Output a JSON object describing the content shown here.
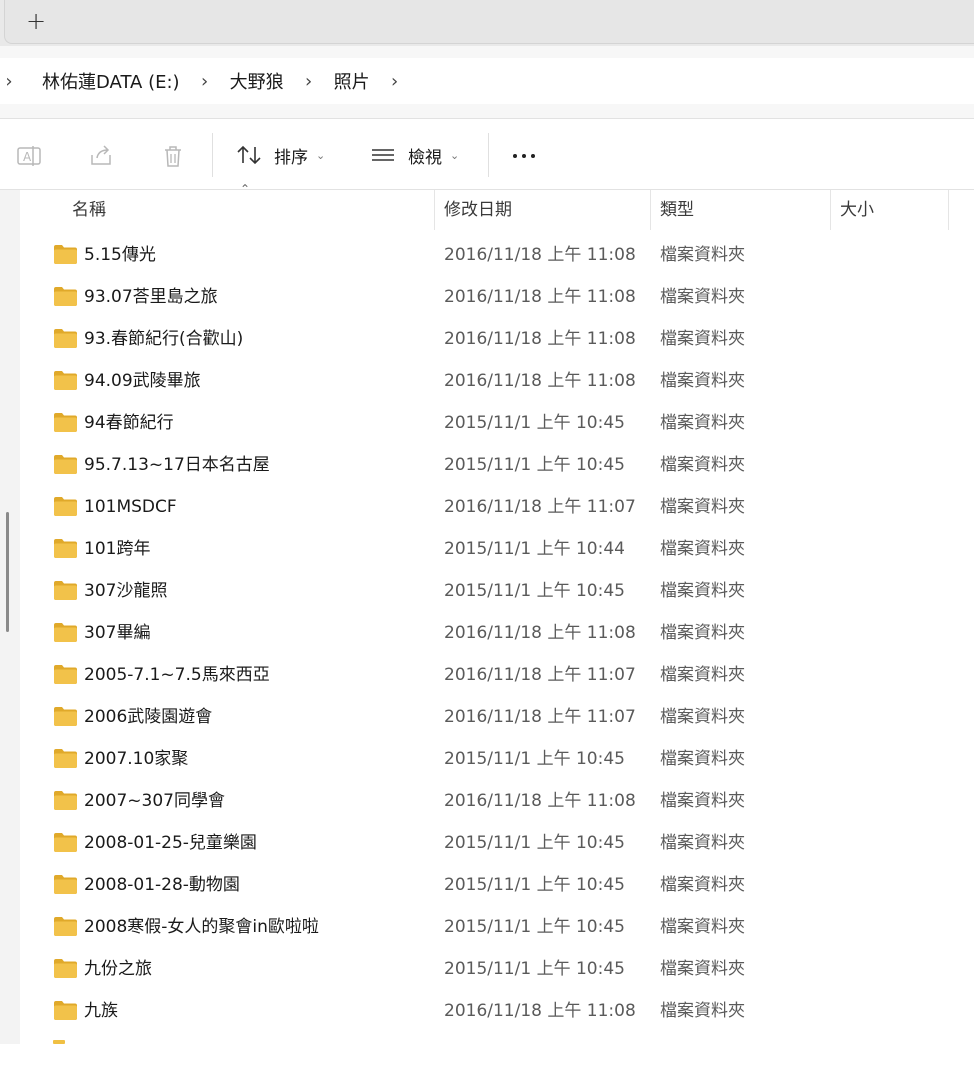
{
  "tabstrip": {
    "new_tab_label": "+"
  },
  "breadcrumb": {
    "items": [
      "林佑蓮DATA (E:)",
      "大野狼",
      "照片"
    ]
  },
  "toolbar": {
    "sort_label": "排序",
    "view_label": "檢視",
    "more_label": "..."
  },
  "columns": {
    "name": "名稱",
    "date": "修改日期",
    "type": "類型",
    "size": "大小"
  },
  "colors": {
    "folder": "#f2c24a",
    "folder_dark": "#e0a92a"
  },
  "files": [
    {
      "name": "5.15傳光",
      "date": "2016/11/18 上午 11:08",
      "type": "檔案資料夾"
    },
    {
      "name": "93.07荅里島之旅",
      "date": "2016/11/18 上午 11:08",
      "type": "檔案資料夾"
    },
    {
      "name": "93.春節紀行(合歡山)",
      "date": "2016/11/18 上午 11:08",
      "type": "檔案資料夾"
    },
    {
      "name": "94.09武陵畢旅",
      "date": "2016/11/18 上午 11:08",
      "type": "檔案資料夾"
    },
    {
      "name": "94春節紀行",
      "date": "2015/11/1 上午 10:45",
      "type": "檔案資料夾"
    },
    {
      "name": "95.7.13~17日本名古屋",
      "date": "2015/11/1 上午 10:45",
      "type": "檔案資料夾"
    },
    {
      "name": "101MSDCF",
      "date": "2016/11/18 上午 11:07",
      "type": "檔案資料夾"
    },
    {
      "name": "101跨年",
      "date": "2015/11/1 上午 10:44",
      "type": "檔案資料夾"
    },
    {
      "name": "307沙龍照",
      "date": "2015/11/1 上午 10:45",
      "type": "檔案資料夾"
    },
    {
      "name": "307畢編",
      "date": "2016/11/18 上午 11:08",
      "type": "檔案資料夾"
    },
    {
      "name": "2005-7.1~7.5馬來西亞",
      "date": "2016/11/18 上午 11:07",
      "type": "檔案資料夾"
    },
    {
      "name": "2006武陵園遊會",
      "date": "2016/11/18 上午 11:07",
      "type": "檔案資料夾"
    },
    {
      "name": "2007.10家聚",
      "date": "2015/11/1 上午 10:45",
      "type": "檔案資料夾"
    },
    {
      "name": "2007~307同學會",
      "date": "2016/11/18 上午 11:08",
      "type": "檔案資料夾"
    },
    {
      "name": "2008-01-25-兒童樂園",
      "date": "2015/11/1 上午 10:45",
      "type": "檔案資料夾"
    },
    {
      "name": "2008-01-28-動物園",
      "date": "2015/11/1 上午 10:45",
      "type": "檔案資料夾"
    },
    {
      "name": "2008寒假-女人的聚會in歐啦啦",
      "date": "2015/11/1 上午 10:45",
      "type": "檔案資料夾"
    },
    {
      "name": "九份之旅",
      "date": "2015/11/1 上午 10:45",
      "type": "檔案資料夾"
    },
    {
      "name": "九族",
      "date": "2016/11/18 上午 11:08",
      "type": "檔案資料夾"
    }
  ]
}
